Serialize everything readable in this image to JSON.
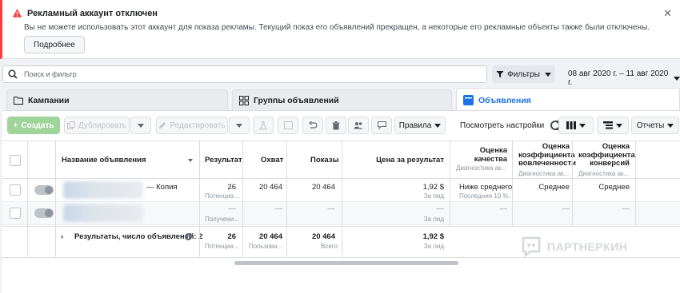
{
  "alert": {
    "title": "Рекламный аккаунт отключен",
    "body": "Вы не можете использовать этот аккаунт для показа рекламы. Текущий показ его объявлений прекращен, а некоторые его рекламные объекты также были отключены.",
    "button": "Подробнее",
    "close": "✕"
  },
  "search": {
    "placeholder": "Поиск и фильтр"
  },
  "filters": {
    "label": "Фильтры"
  },
  "date_range": "08 авг 2020 г. – 11 авг 2020 г.",
  "tabs": [
    {
      "label": "Кампании"
    },
    {
      "label": "Группы объявлений"
    },
    {
      "label": "Объявления"
    }
  ],
  "toolbar": {
    "create": "Создать",
    "duplicate": "Дублировать",
    "edit": "Редактировать",
    "rules": "Правила",
    "view_settings": "Посмотреть настройки",
    "reports": "Отчеты"
  },
  "table": {
    "headers": {
      "name": "Название объявления",
      "result": "Результат",
      "reach": "Охват",
      "impressions": "Показы",
      "cost": "Цена за результат",
      "quality": "Оценка качества",
      "quality_sub": "Диагностика ак...",
      "engagement": "Оценка коэффициента вовлеченности",
      "engagement_sub": "Диагностика ак...",
      "conversion": "Оценка коэффициента конверсий",
      "conversion_sub": "Диагностика ак..."
    },
    "rows": [
      {
        "name_suffix": "— Копия",
        "result": "26",
        "result_sub": "Потенциа...",
        "reach": "20 464",
        "impressions": "20 464",
        "cost": "1,92 $",
        "cost_sub": "За лид",
        "quality": "Ниже среднего",
        "quality_sub": "Последние 10 %...",
        "engagement": "Среднее",
        "conversion": "Среднее"
      },
      {
        "name_suffix": "",
        "result": "—",
        "result_sub": "Получени...",
        "reach": "—",
        "impressions": "—",
        "cost": "—",
        "cost_sub": "За лид",
        "quality": "—",
        "quality_sub": "",
        "engagement": "—",
        "conversion": "—"
      }
    ],
    "total": {
      "label": "Результаты, число объявлений: 2",
      "result": "26",
      "result_sub": "Потенциа...",
      "reach": "20 464",
      "reach_sub": "Пользова...",
      "impressions": "20 464",
      "impressions_sub": "Всего",
      "cost": "1,92 $",
      "cost_sub": "За лид"
    }
  },
  "watermark": "ПАРТНЕРКИН",
  "colors": {
    "accent": "#1b74e4",
    "alert": "#fa3e3e",
    "create": "#9fd49a"
  }
}
